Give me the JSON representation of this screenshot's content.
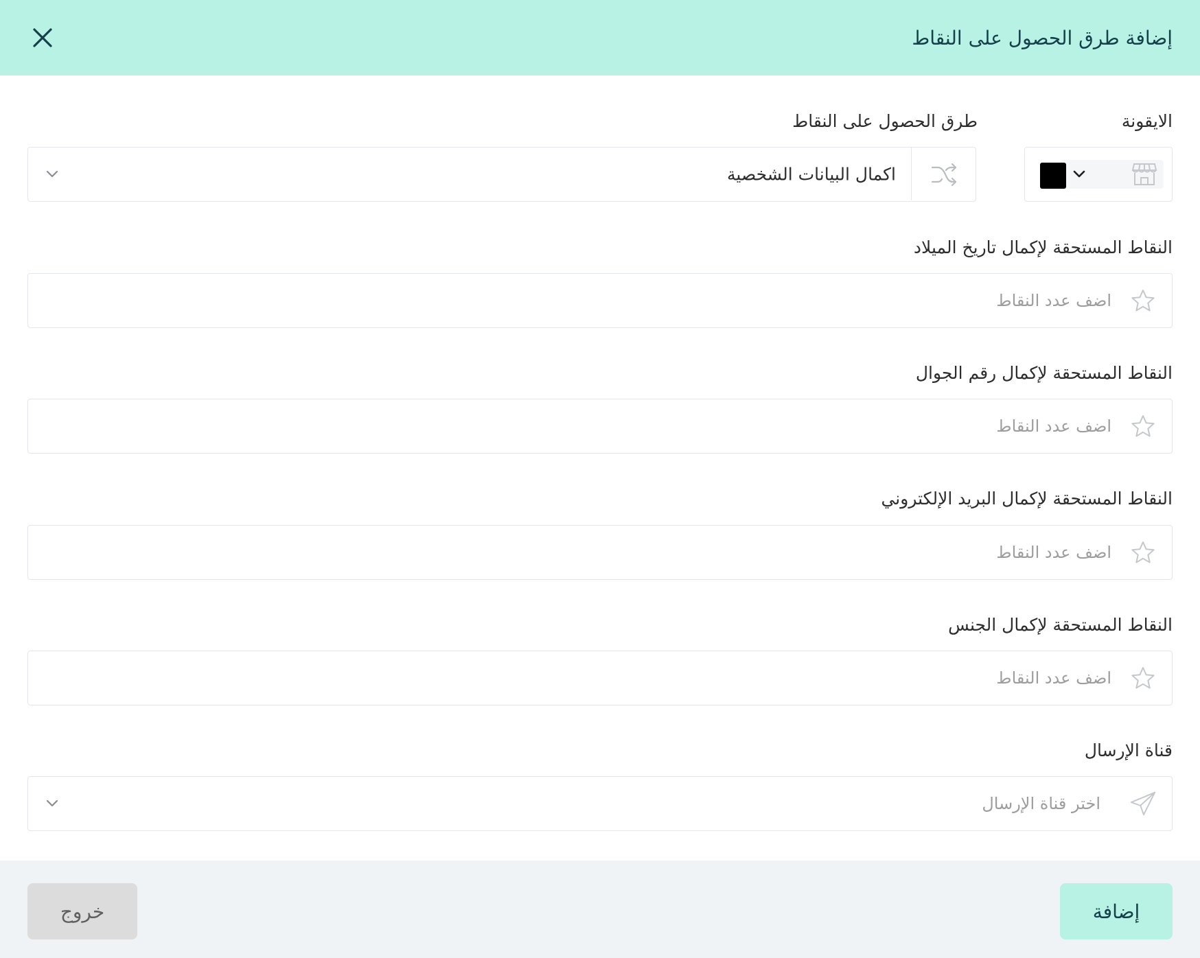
{
  "header": {
    "title": "إضافة طرق الحصول على النقاط"
  },
  "icon_field": {
    "label": "الايقونة",
    "selected_icon": "store-icon",
    "selected_color": "#000000"
  },
  "method_field": {
    "label": "طرق الحصول على النقاط",
    "value": "اكمال البيانات الشخصية",
    "icon": "shuffle-icon"
  },
  "points_fields": [
    {
      "label": "النقاط المستحقة لإكمال تاريخ الميلاد",
      "placeholder": "اضف عدد النقاط"
    },
    {
      "label": "النقاط المستحقة لإكمال رقم الجوال",
      "placeholder": "اضف عدد النقاط"
    },
    {
      "label": "النقاط المستحقة لإكمال البريد الإلكتروني",
      "placeholder": "اضف عدد النقاط"
    },
    {
      "label": "النقاط المستحقة لإكمال الجنس",
      "placeholder": "اضف عدد النقاط"
    }
  ],
  "channel_field": {
    "label": "قناة الإرسال",
    "placeholder": "اختر قناة الإرسال",
    "icon": "send-icon"
  },
  "footer": {
    "add_label": "إضافة",
    "exit_label": "خروج"
  },
  "colors": {
    "accent": "#b8f2e4",
    "accent_text": "#14404a",
    "footer_bg": "#eff3f6",
    "border": "#e3e6ea"
  }
}
